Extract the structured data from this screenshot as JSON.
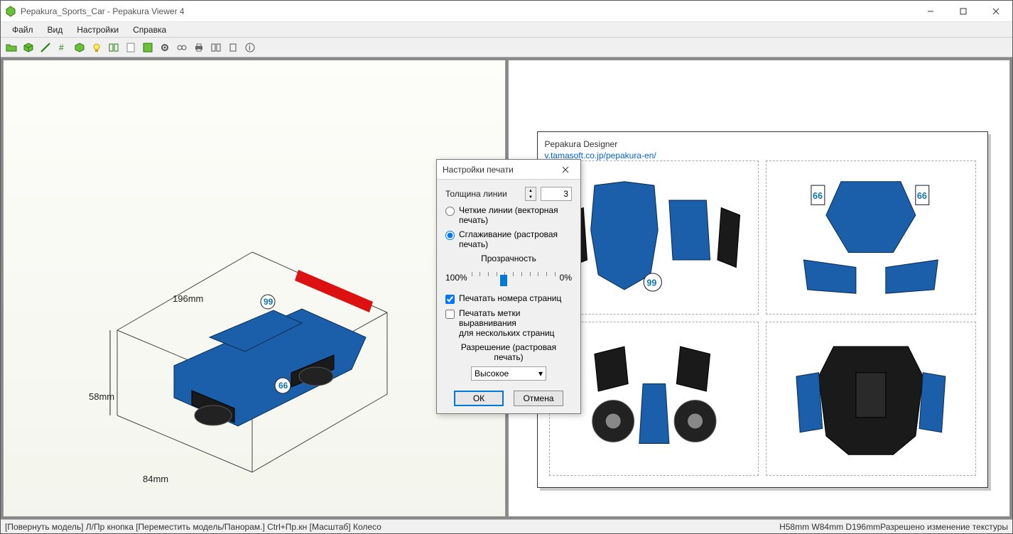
{
  "window": {
    "title": "Pepakura_Sports_Car - Pepakura Viewer 4"
  },
  "menu": {
    "file": "Файл",
    "view": "Вид",
    "settings": "Настройки",
    "help": "Справка"
  },
  "model": {
    "dim_depth": "196mm",
    "dim_height": "58mm",
    "dim_width": "84mm",
    "badge1": "99",
    "badge2": "66"
  },
  "paper": {
    "appname": "Pepakura Designer",
    "url_frag": "v.tamasoft.co.jp/pepakura-en/",
    "badge1": "99",
    "badge2": "66"
  },
  "dialog": {
    "title": "Настройки печати",
    "line_width_label": "Толщина линии",
    "line_width_value": "3",
    "opt_vector": "Четкие линии (векторная печать)",
    "opt_raster": "Сглаживание (растровая печать)",
    "transparency_label": "Прозрачность",
    "slider_min": "100%",
    "slider_max": "0%",
    "check_pagenum": "Печатать номера страниц",
    "check_align1": "Печатать метки выравнивания",
    "check_align2": "для нескольких страниц",
    "resolution_label": "Разрешение (растровая печать)",
    "resolution_value": "Высокое",
    "ok": "ОК",
    "cancel": "Отмена"
  },
  "status": {
    "left": "[Повернуть модель] Л/Пр кнопка [Переместить модель/Панорам.] Ctrl+Пр.кн [Масштаб] Колесо",
    "right": "H58mm W84mm D196mmРазрешено изменение текстуры"
  }
}
